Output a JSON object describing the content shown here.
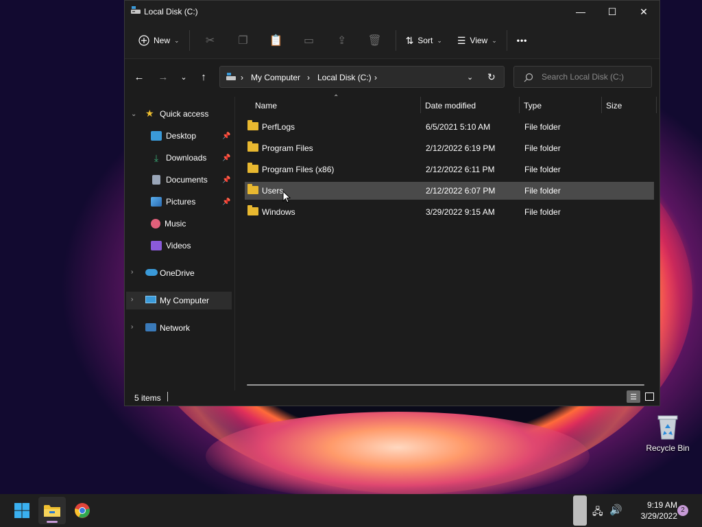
{
  "window": {
    "title": "Local Disk (C:)",
    "minimize": "—",
    "maximize": "☐",
    "close": "✕"
  },
  "toolbar": {
    "new_label": "New",
    "sort_label": "Sort",
    "view_label": "View",
    "more_label": "•••"
  },
  "address": {
    "crumbs": [
      "My Computer",
      "Local Disk (C:)"
    ],
    "separator": "›"
  },
  "search": {
    "placeholder": "Search Local Disk (C:)"
  },
  "nav": {
    "quick_access": "Quick access",
    "items": [
      {
        "label": "Desktop",
        "icon": "desktop-icon",
        "color": "#3a9ad9",
        "pinned": true
      },
      {
        "label": "Downloads",
        "icon": "download-icon",
        "color": "#3bb07a",
        "pinned": true
      },
      {
        "label": "Documents",
        "icon": "document-icon",
        "color": "#9aa6b8",
        "pinned": true
      },
      {
        "label": "Pictures",
        "icon": "pictures-icon",
        "color": "#3a8ad9",
        "pinned": true
      },
      {
        "label": "Music",
        "icon": "music-icon",
        "color": "#e0607a",
        "pinned": false
      },
      {
        "label": "Videos",
        "icon": "videos-icon",
        "color": "#8a5ad9",
        "pinned": false
      }
    ],
    "onedrive": "OneDrive",
    "my_computer": "My Computer",
    "network": "Network"
  },
  "columns": {
    "name": "Name",
    "date": "Date modified",
    "type": "Type",
    "size": "Size"
  },
  "files": [
    {
      "name": "PerfLogs",
      "date": "6/5/2021 5:10 AM",
      "type": "File folder",
      "selected": false
    },
    {
      "name": "Program Files",
      "date": "2/12/2022 6:19 PM",
      "type": "File folder",
      "selected": false
    },
    {
      "name": "Program Files (x86)",
      "date": "2/12/2022 6:11 PM",
      "type": "File folder",
      "selected": false
    },
    {
      "name": "Users",
      "date": "2/12/2022 6:07 PM",
      "type": "File folder",
      "selected": true
    },
    {
      "name": "Windows",
      "date": "3/29/2022 9:15 AM",
      "type": "File folder",
      "selected": false
    }
  ],
  "status": {
    "items_count": "5 items"
  },
  "desktop": {
    "recycle_bin": "Recycle Bin"
  },
  "taskbar": {
    "time": "9:19 AM",
    "date": "3/29/2022",
    "notifications": "2"
  },
  "colors": {
    "accent": "#3a9ad9",
    "folder": "#e8b830",
    "selected_row": "#4a4a4a"
  }
}
